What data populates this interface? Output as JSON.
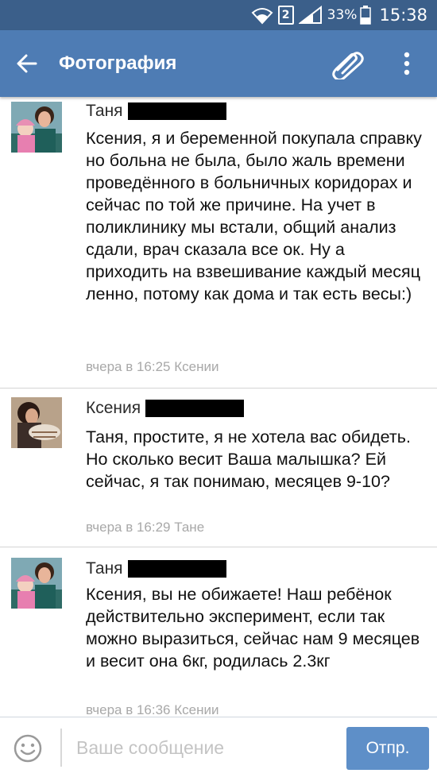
{
  "status_bar": {
    "sim_label": "2",
    "battery_percent": "33%",
    "time": "15:38",
    "icons": [
      "wifi-icon",
      "sim-icon",
      "signal-icon",
      "battery-icon"
    ]
  },
  "app_bar": {
    "title": "Фотография",
    "back_icon": "arrow-left-icon",
    "attach_icon": "paperclip-icon",
    "more_icon": "more-vertical-icon",
    "background_color": "#4e7cb4",
    "status_color": "#3b5f8a"
  },
  "messages": [
    {
      "author": "Таня",
      "author_redacted": true,
      "text": "Ксения, я и беременной покупала справку но больна не была, было жаль времени проведённого в больничных коридорах и сейчас по той же причине. На учет в поликлинику мы встали, общий анализ сдали, врач сказала все ок. Ну а приходить на взвешивание каждый месяц ленно, потому как дома и так есть весы:)",
      "meta": "вчера в 16:25 Ксении"
    },
    {
      "author": "Ксения",
      "author_redacted": true,
      "text": "Таня, простите, я не хотела вас обидеть. Но сколько весит Ваша малышка? Ей сейчас, я так понимаю, месяцев 9-10?",
      "meta": "вчера в 16:29 Тане"
    },
    {
      "author": "Таня",
      "author_redacted": true,
      "text": "Ксения, вы не обижаете! Наш ребёнок действительно эксперимент, если так можно выразиться, сейчас нам 9 месяцев и весит она 6кг, родилась 2.3кг",
      "meta": "вчера в 16:36 Ксении"
    }
  ],
  "composer": {
    "placeholder": "Ваше сообщение",
    "value": "",
    "send_label": "Отпр.",
    "emoji_icon": "smiley-icon",
    "send_color": "#5e8fc8"
  }
}
